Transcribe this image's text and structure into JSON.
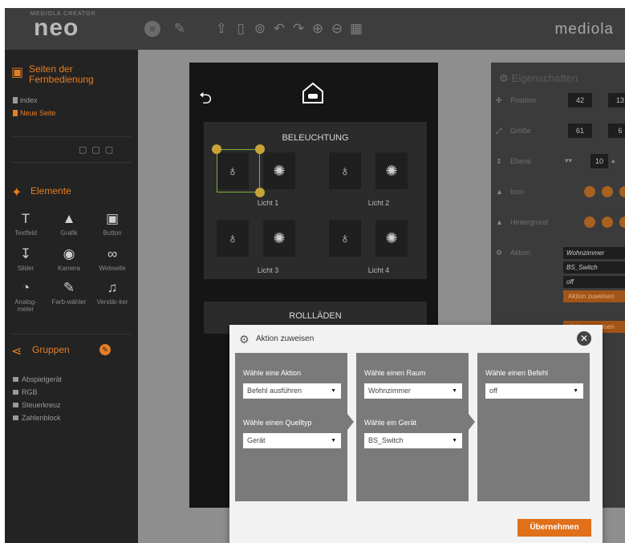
{
  "toolbar": {
    "logo_sub": "MEDIOLA CREATOR",
    "logo": "neo",
    "brand": "mediola",
    "icons": [
      "menu-icon",
      "pin-icon",
      "upload-icon",
      "device-icon",
      "download-icon",
      "undo-icon",
      "redo-icon",
      "zoom-in-icon",
      "zoom-out-icon",
      "grid-icon"
    ]
  },
  "sidebar": {
    "pages_title": "Seiten der Fernbedienung",
    "pages": [
      {
        "label": "index",
        "active": false
      },
      {
        "label": "Neue Seite",
        "active": true
      }
    ],
    "elements_title": "Elemente",
    "elements": [
      {
        "label": "Textfeld",
        "icon": "text-icon"
      },
      {
        "label": "Grafik",
        "icon": "image-icon"
      },
      {
        "label": "Button",
        "icon": "button-icon"
      },
      {
        "label": "Slider",
        "icon": "slider-icon"
      },
      {
        "label": "Kamera",
        "icon": "camera-icon"
      },
      {
        "label": "Webseite",
        "icon": "link-icon"
      },
      {
        "label": "Analog-meter",
        "icon": "gauge-icon"
      },
      {
        "label": "Farb-wähler",
        "icon": "color-picker-icon"
      },
      {
        "label": "Verstär-ker",
        "icon": "music-icon"
      }
    ],
    "groups_title": "Gruppen",
    "groups": [
      "Abspielgerät",
      "RGB",
      "Steuerkreuz",
      "Zahlenblock"
    ]
  },
  "phone": {
    "room1": "BELEUCHTUNG",
    "lights": [
      "Licht 1",
      "Licht 2",
      "Licht 3",
      "Licht 4"
    ],
    "room2": "ROLLLÄDEN"
  },
  "props": {
    "title": "Eigenschaften",
    "position_label": "Position",
    "position_x": "42",
    "position_y": "13",
    "size_label": "Größe",
    "size_w": "61",
    "size_h": "6",
    "layer_label": "Ebene",
    "layer_value": "10",
    "icon_label": "Icon",
    "bg_label": "Hintergrund",
    "action_label": "Aktion",
    "action_room": "Wohnzimmer",
    "action_device": "BS_Switch",
    "action_cmd": "off",
    "assign_button": "Aktion zuweisen",
    "assign_button2": "Aktion zuweisen"
  },
  "dialog": {
    "title": "Aktion zuweisen",
    "col1": {
      "label1": "Wähle eine Aktion",
      "value1": "Befehl ausführen",
      "label2": "Wähle einen Quelltyp",
      "value2": "Gerät"
    },
    "col2": {
      "label1": "Wähle einen Raum",
      "value1": "Wohnzimmer",
      "label2": "Wähle ein Gerät",
      "value2": "BS_Switch"
    },
    "col3": {
      "label1": "Wähle einen Befehl",
      "value1": "off"
    },
    "apply_button": "Übernehmen"
  },
  "colors": {
    "accent": "#e67e22",
    "apply_button": "#e0701a",
    "selection": "#7bb13a",
    "handle": "#c7a43a"
  }
}
